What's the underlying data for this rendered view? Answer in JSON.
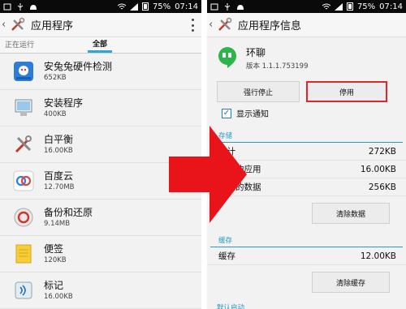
{
  "status_bar": {
    "battery": "75%",
    "time": "07:14"
  },
  "left": {
    "title": "应用程序",
    "tabs": [
      "正在运行",
      "全部"
    ],
    "apps": [
      {
        "name": "安兔兔硬件检测",
        "size": "652KB",
        "icon": "antutu-icon"
      },
      {
        "name": "安装程序",
        "size": "400KB",
        "icon": "installer-icon"
      },
      {
        "name": "白平衡",
        "size": "16.00KB",
        "icon": "tools-icon"
      },
      {
        "name": "百度云",
        "size": "12.70MB",
        "icon": "baidu-cloud-icon"
      },
      {
        "name": "备份和还原",
        "size": "9.14MB",
        "icon": "backup-icon"
      },
      {
        "name": "便签",
        "size": "120KB",
        "icon": "notepad-icon"
      },
      {
        "name": "标记",
        "size": "16.00KB",
        "icon": "nfc-tag-icon"
      }
    ]
  },
  "right": {
    "title": "应用程序信息",
    "app_name": "环聊",
    "version": "版本 1.1.1.753199",
    "force_stop": "强行停止",
    "disable": "停用",
    "show_notifications": "显示通知",
    "storage_header": "存储",
    "storage_rows": [
      {
        "label": "总计",
        "value": "272KB"
      },
      {
        "label": "备上的应用",
        "value": "16.00KB"
      },
      {
        "label": "备上的数据",
        "value": "256KB"
      }
    ],
    "clear_data": "清除数据",
    "cache_header": "缓存",
    "cache_label": "缓存",
    "cache_value": "12.00KB",
    "clear_cache": "清除缓存",
    "partial_header": "默认启动"
  },
  "colors": {
    "accent": "#2a98c9",
    "arrow": "#e8141a",
    "highlight": "#e0262a"
  }
}
